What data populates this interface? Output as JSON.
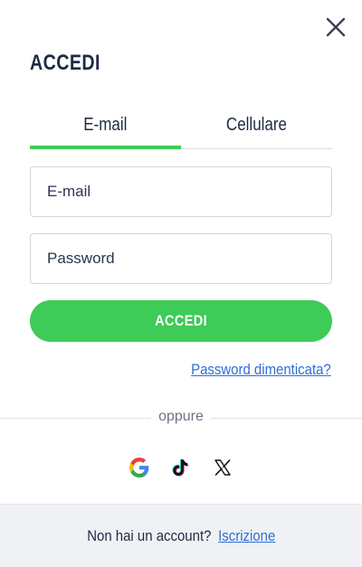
{
  "header": {
    "title": "ACCEDI"
  },
  "tabs": [
    {
      "label": "E-mail",
      "active": true
    },
    {
      "label": "Cellulare",
      "active": false
    }
  ],
  "form": {
    "email_placeholder": "E-mail",
    "password_placeholder": "Password",
    "submit_label": "ACCEDI",
    "forgot_label": "Password dimenticata?"
  },
  "divider": {
    "label": "oppure"
  },
  "socials": [
    {
      "icon": "google-icon"
    },
    {
      "icon": "tiktok-icon"
    },
    {
      "icon": "x-icon"
    }
  ],
  "footer": {
    "prompt": "Non hai un account?",
    "link_label": "Iscrizione"
  },
  "colors": {
    "accent": "#3ecb57",
    "link": "#2d6fd6",
    "text": "#1f2a44"
  }
}
